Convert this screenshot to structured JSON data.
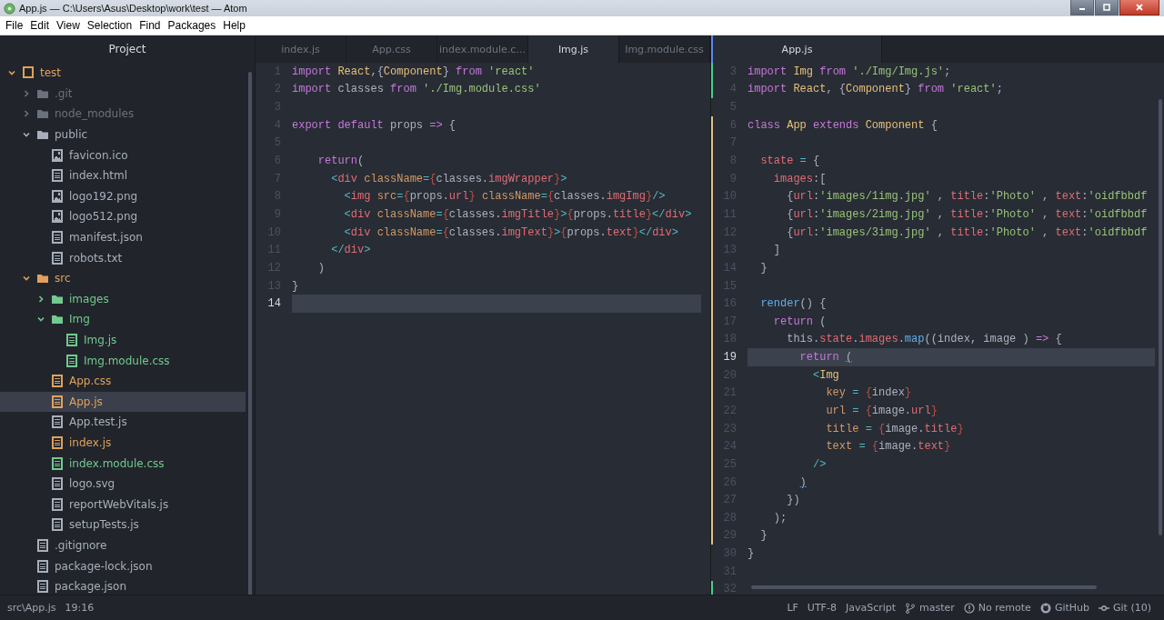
{
  "window": {
    "title": "App.js — C:\\Users\\Asus\\Desktop\\work\\test — Atom"
  },
  "menu": [
    "File",
    "Edit",
    "View",
    "Selection",
    "Find",
    "Packages",
    "Help"
  ],
  "sidebar": {
    "title": "Project",
    "tree": [
      {
        "name": "test",
        "kind": "repo",
        "color": "#e0a15d",
        "expanded": true,
        "selected": false,
        "children": [
          {
            "name": ".git",
            "kind": "folder",
            "color": "#6b717d",
            "expanded": false,
            "selected": false
          },
          {
            "name": "node_modules",
            "kind": "folder",
            "color": "#6b717d",
            "expanded": false,
            "selected": false
          },
          {
            "name": "public",
            "kind": "folder",
            "color": "#a8afbb",
            "expanded": true,
            "selected": false,
            "children": [
              {
                "name": "favicon.ico",
                "kind": "image",
                "color": "#a8afbb",
                "selected": false
              },
              {
                "name": "index.html",
                "kind": "file",
                "color": "#a8afbb",
                "selected": false
              },
              {
                "name": "logo192.png",
                "kind": "image",
                "color": "#a8afbb",
                "selected": false
              },
              {
                "name": "logo512.png",
                "kind": "image",
                "color": "#a8afbb",
                "selected": false
              },
              {
                "name": "manifest.json",
                "kind": "file",
                "color": "#a8afbb",
                "selected": false
              },
              {
                "name": "robots.txt",
                "kind": "file",
                "color": "#a8afbb",
                "selected": false
              }
            ]
          },
          {
            "name": "src",
            "kind": "folder",
            "color": "#e0a15d",
            "expanded": true,
            "selected": false,
            "children": [
              {
                "name": "images",
                "kind": "folder",
                "color": "#73c990",
                "expanded": false,
                "selected": false
              },
              {
                "name": "Img",
                "kind": "folder",
                "color": "#73c990",
                "expanded": true,
                "selected": false,
                "children": [
                  {
                    "name": "Img.js",
                    "kind": "file",
                    "color": "#73c990",
                    "selected": false
                  },
                  {
                    "name": "Img.module.css",
                    "kind": "file",
                    "color": "#73c990",
                    "selected": false
                  }
                ]
              },
              {
                "name": "App.css",
                "kind": "file",
                "color": "#e0a15d",
                "selected": false
              },
              {
                "name": "App.js",
                "kind": "file",
                "color": "#e0a15d",
                "selected": true
              },
              {
                "name": "App.test.js",
                "kind": "file",
                "color": "#a8afbb",
                "selected": false
              },
              {
                "name": "index.js",
                "kind": "file",
                "color": "#e0a15d",
                "selected": false
              },
              {
                "name": "index.module.css",
                "kind": "file",
                "color": "#73c990",
                "selected": false
              },
              {
                "name": "logo.svg",
                "kind": "file",
                "color": "#a8afbb",
                "selected": false
              },
              {
                "name": "reportWebVitals.js",
                "kind": "file",
                "color": "#a8afbb",
                "selected": false
              },
              {
                "name": "setupTests.js",
                "kind": "file",
                "color": "#a8afbb",
                "selected": false
              }
            ]
          },
          {
            "name": ".gitignore",
            "kind": "file",
            "color": "#a8afbb",
            "selected": false
          },
          {
            "name": "package-lock.json",
            "kind": "file",
            "color": "#a8afbb",
            "selected": false
          },
          {
            "name": "package.json",
            "kind": "file",
            "color": "#a8afbb",
            "selected": false
          }
        ]
      }
    ]
  },
  "panes": [
    {
      "tabs": [
        {
          "label": "index.js",
          "selected": false
        },
        {
          "label": "App.css",
          "selected": false
        },
        {
          "label": "index.module.c...",
          "selected": false
        },
        {
          "label": "Img.js",
          "selected": true
        },
        {
          "label": "Img.module.css",
          "selected": false
        }
      ],
      "lines": [
        {
          "number": "1",
          "current": false,
          "tokens": [
            {
              "kind": "kw",
              "text": "import "
            },
            {
              "kind": "cls",
              "text": "React"
            },
            {
              "kind": "plain",
              "text": ",{"
            },
            {
              "kind": "cls",
              "text": "Component"
            },
            {
              "kind": "plain",
              "text": "} "
            },
            {
              "kind": "kw",
              "text": "from "
            },
            {
              "kind": "str",
              "text": "'react'"
            }
          ]
        },
        {
          "number": "2",
          "current": false,
          "tokens": [
            {
              "kind": "kw",
              "text": "import "
            },
            {
              "kind": "plain",
              "text": "classes "
            },
            {
              "kind": "kw",
              "text": "from "
            },
            {
              "kind": "str",
              "text": "'./Img.module.css'"
            }
          ]
        },
        {
          "number": "3",
          "current": false
        },
        {
          "number": "4",
          "current": false,
          "tokens": [
            {
              "kind": "kw",
              "text": "export default "
            },
            {
              "kind": "plain",
              "text": "props "
            },
            {
              "kind": "kw",
              "text": "=> "
            },
            {
              "kind": "plain",
              "text": "{"
            }
          ]
        },
        {
          "number": "5",
          "current": false
        },
        {
          "number": "6",
          "current": false,
          "tokens": [
            {
              "kind": "kw",
              "text": "    return"
            },
            {
              "kind": "plain",
              "text": "("
            }
          ]
        },
        {
          "number": "7",
          "current": false,
          "tokens": [
            {
              "kind": "op",
              "text": "      <"
            },
            {
              "kind": "tag",
              "text": "div "
            },
            {
              "kind": "attr",
              "text": "className"
            },
            {
              "kind": "op",
              "text": "="
            },
            {
              "kind": "brace",
              "text": "{"
            },
            {
              "kind": "plain",
              "text": "classes."
            },
            {
              "kind": "prop",
              "text": "imgWrapper"
            },
            {
              "kind": "brace",
              "text": "}"
            },
            {
              "kind": "op",
              "text": ">"
            }
          ]
        },
        {
          "number": "8",
          "current": false,
          "tokens": [
            {
              "kind": "op",
              "text": "        <"
            },
            {
              "kind": "tag",
              "text": "img "
            },
            {
              "kind": "attr",
              "text": "src"
            },
            {
              "kind": "op",
              "text": "="
            },
            {
              "kind": "brace",
              "text": "{"
            },
            {
              "kind": "plain",
              "text": "props."
            },
            {
              "kind": "prop",
              "text": "url"
            },
            {
              "kind": "brace",
              "text": "} "
            },
            {
              "kind": "attr",
              "text": "className"
            },
            {
              "kind": "op",
              "text": "="
            },
            {
              "kind": "brace",
              "text": "{"
            },
            {
              "kind": "plain",
              "text": "classes."
            },
            {
              "kind": "prop",
              "text": "imgImg"
            },
            {
              "kind": "brace",
              "text": "}"
            },
            {
              "kind": "op",
              "text": "/>"
            }
          ]
        },
        {
          "number": "9",
          "current": false,
          "tokens": [
            {
              "kind": "op",
              "text": "        <"
            },
            {
              "kind": "tag",
              "text": "div "
            },
            {
              "kind": "attr",
              "text": "className"
            },
            {
              "kind": "op",
              "text": "="
            },
            {
              "kind": "brace",
              "text": "{"
            },
            {
              "kind": "plain",
              "text": "classes."
            },
            {
              "kind": "prop",
              "text": "imgTitle"
            },
            {
              "kind": "brace",
              "text": "}"
            },
            {
              "kind": "op",
              "text": ">"
            },
            {
              "kind": "brace",
              "text": "{"
            },
            {
              "kind": "plain",
              "text": "props."
            },
            {
              "kind": "prop",
              "text": "title"
            },
            {
              "kind": "brace",
              "text": "}"
            },
            {
              "kind": "op",
              "text": "</"
            },
            {
              "kind": "tag",
              "text": "div"
            },
            {
              "kind": "op",
              "text": ">"
            }
          ]
        },
        {
          "number": "10",
          "current": false,
          "tokens": [
            {
              "kind": "op",
              "text": "        <"
            },
            {
              "kind": "tag",
              "text": "div "
            },
            {
              "kind": "attr",
              "text": "className"
            },
            {
              "kind": "op",
              "text": "="
            },
            {
              "kind": "brace",
              "text": "{"
            },
            {
              "kind": "plain",
              "text": "classes."
            },
            {
              "kind": "prop",
              "text": "imgText"
            },
            {
              "kind": "brace",
              "text": "}"
            },
            {
              "kind": "op",
              "text": ">"
            },
            {
              "kind": "brace",
              "text": "{"
            },
            {
              "kind": "plain",
              "text": "props."
            },
            {
              "kind": "prop",
              "text": "text"
            },
            {
              "kind": "brace",
              "text": "}"
            },
            {
              "kind": "op",
              "text": "</"
            },
            {
              "kind": "tag",
              "text": "div"
            },
            {
              "kind": "op",
              "text": ">"
            }
          ]
        },
        {
          "number": "11",
          "current": false,
          "tokens": [
            {
              "kind": "op",
              "text": "      </"
            },
            {
              "kind": "tag",
              "text": "div"
            },
            {
              "kind": "op",
              "text": ">"
            }
          ]
        },
        {
          "number": "12",
          "current": false,
          "tokens": [
            {
              "kind": "plain",
              "text": "    )"
            }
          ]
        },
        {
          "number": "13",
          "current": false,
          "tokens": [
            {
              "kind": "plain",
              "text": "}"
            }
          ]
        },
        {
          "number": "14",
          "current": true
        }
      ]
    },
    {
      "tabs": [
        {
          "label": "App.js",
          "selected": true
        }
      ],
      "lines": [
        {
          "number": "3",
          "current": false,
          "color": "#43d08a",
          "tokens": [
            {
              "kind": "kw",
              "text": "import "
            },
            {
              "kind": "cls",
              "text": "Img "
            },
            {
              "kind": "kw",
              "text": "from "
            },
            {
              "kind": "str",
              "text": "'./Img/Img.js'"
            },
            {
              "kind": "plain",
              "text": ";"
            }
          ]
        },
        {
          "number": "4",
          "current": false,
          "color": "#43d08a",
          "tokens": [
            {
              "kind": "kw",
              "text": "import "
            },
            {
              "kind": "cls",
              "text": "React"
            },
            {
              "kind": "plain",
              "text": ", {"
            },
            {
              "kind": "cls",
              "text": "Component"
            },
            {
              "kind": "plain",
              "text": "} "
            },
            {
              "kind": "kw",
              "text": "from "
            },
            {
              "kind": "str",
              "text": "'react'"
            },
            {
              "kind": "plain",
              "text": ";"
            }
          ]
        },
        {
          "number": "5",
          "current": false
        },
        {
          "number": "6",
          "current": false,
          "color": "#e0c285",
          "tokens": [
            {
              "kind": "kw",
              "text": "class "
            },
            {
              "kind": "cls",
              "text": "App "
            },
            {
              "kind": "kw",
              "text": "extends "
            },
            {
              "kind": "cls",
              "text": "Component "
            },
            {
              "kind": "plain",
              "text": "{"
            }
          ]
        },
        {
          "number": "7",
          "current": false,
          "color": "#e0c285"
        },
        {
          "number": "8",
          "current": false,
          "color": "#e0c285",
          "tokens": [
            {
              "kind": "prop",
              "text": "  state "
            },
            {
              "kind": "op",
              "text": "= "
            },
            {
              "kind": "plain",
              "text": "{"
            }
          ]
        },
        {
          "number": "9",
          "current": false,
          "color": "#e0c285",
          "tokens": [
            {
              "kind": "prop",
              "text": "    images"
            },
            {
              "kind": "plain",
              "text": ":["
            }
          ]
        },
        {
          "number": "10",
          "current": false,
          "color": "#e0c285",
          "tokens": [
            {
              "kind": "plain",
              "text": "      {"
            },
            {
              "kind": "prop",
              "text": "url"
            },
            {
              "kind": "plain",
              "text": ":"
            },
            {
              "kind": "str",
              "text": "'images/1img.jpg'"
            },
            {
              "kind": "plain",
              "text": " , "
            },
            {
              "kind": "prop",
              "text": "title"
            },
            {
              "kind": "plain",
              "text": ":"
            },
            {
              "kind": "str",
              "text": "'Photo'"
            },
            {
              "kind": "plain",
              "text": " , "
            },
            {
              "kind": "prop",
              "text": "text"
            },
            {
              "kind": "plain",
              "text": ":"
            },
            {
              "kind": "str",
              "text": "'oidfbbdf"
            }
          ]
        },
        {
          "number": "11",
          "current": false,
          "color": "#e0c285",
          "tokens": [
            {
              "kind": "plain",
              "text": "      {"
            },
            {
              "kind": "prop",
              "text": "url"
            },
            {
              "kind": "plain",
              "text": ":"
            },
            {
              "kind": "str",
              "text": "'images/2img.jpg'"
            },
            {
              "kind": "plain",
              "text": " , "
            },
            {
              "kind": "prop",
              "text": "title"
            },
            {
              "kind": "plain",
              "text": ":"
            },
            {
              "kind": "str",
              "text": "'Photo'"
            },
            {
              "kind": "plain",
              "text": " , "
            },
            {
              "kind": "prop",
              "text": "text"
            },
            {
              "kind": "plain",
              "text": ":"
            },
            {
              "kind": "str",
              "text": "'oidfbbdf"
            }
          ]
        },
        {
          "number": "12",
          "current": false,
          "color": "#e0c285",
          "tokens": [
            {
              "kind": "plain",
              "text": "      {"
            },
            {
              "kind": "prop",
              "text": "url"
            },
            {
              "kind": "plain",
              "text": ":"
            },
            {
              "kind": "str",
              "text": "'images/3img.jpg'"
            },
            {
              "kind": "plain",
              "text": " , "
            },
            {
              "kind": "prop",
              "text": "title"
            },
            {
              "kind": "plain",
              "text": ":"
            },
            {
              "kind": "str",
              "text": "'Photo'"
            },
            {
              "kind": "plain",
              "text": " , "
            },
            {
              "kind": "prop",
              "text": "text"
            },
            {
              "kind": "plain",
              "text": ":"
            },
            {
              "kind": "str",
              "text": "'oidfbbdf"
            }
          ]
        },
        {
          "number": "13",
          "current": false,
          "color": "#e0c285",
          "tokens": [
            {
              "kind": "plain",
              "text": "    ]"
            }
          ]
        },
        {
          "number": "14",
          "current": false,
          "color": "#e0c285",
          "tokens": [
            {
              "kind": "plain",
              "text": "  }"
            }
          ]
        },
        {
          "number": "15",
          "current": false,
          "color": "#e0c285"
        },
        {
          "number": "16",
          "current": false,
          "color": "#e0c285",
          "tokens": [
            {
              "kind": "fn",
              "text": "  render"
            },
            {
              "kind": "plain",
              "text": "() {"
            }
          ]
        },
        {
          "number": "17",
          "current": false,
          "color": "#e0c285",
          "tokens": [
            {
              "kind": "kw",
              "text": "    return "
            },
            {
              "kind": "plain",
              "text": "("
            }
          ]
        },
        {
          "number": "18",
          "current": false,
          "color": "#e0c285",
          "tokens": [
            {
              "kind": "plain",
              "text": "      this."
            },
            {
              "kind": "prop",
              "text": "state"
            },
            {
              "kind": "plain",
              "text": "."
            },
            {
              "kind": "prop",
              "text": "images"
            },
            {
              "kind": "plain",
              "text": "."
            },
            {
              "kind": "fn",
              "text": "map"
            },
            {
              "kind": "plain",
              "text": "((index, image ) "
            },
            {
              "kind": "kw",
              "text": "=> "
            },
            {
              "kind": "plain",
              "text": "{"
            }
          ]
        },
        {
          "number": "19",
          "current": true,
          "color": "#e0c285",
          "tokens": [
            {
              "kind": "kw",
              "text": "        return "
            },
            {
              "kind": "match",
              "text": "("
            }
          ]
        },
        {
          "number": "20",
          "current": false,
          "color": "#e0c285",
          "tokens": [
            {
              "kind": "op",
              "text": "          <"
            },
            {
              "kind": "cls",
              "text": "Img"
            }
          ]
        },
        {
          "number": "21",
          "current": false,
          "color": "#e0c285",
          "tokens": [
            {
              "kind": "attr",
              "text": "            key "
            },
            {
              "kind": "op",
              "text": "= "
            },
            {
              "kind": "brace",
              "text": "{"
            },
            {
              "kind": "plain",
              "text": "index"
            },
            {
              "kind": "brace",
              "text": "}"
            }
          ]
        },
        {
          "number": "22",
          "current": false,
          "color": "#e0c285",
          "tokens": [
            {
              "kind": "attr",
              "text": "            url "
            },
            {
              "kind": "op",
              "text": "= "
            },
            {
              "kind": "brace",
              "text": "{"
            },
            {
              "kind": "plain",
              "text": "image."
            },
            {
              "kind": "prop",
              "text": "url"
            },
            {
              "kind": "brace",
              "text": "}"
            }
          ]
        },
        {
          "number": "23",
          "current": false,
          "color": "#e0c285",
          "tokens": [
            {
              "kind": "attr",
              "text": "            title "
            },
            {
              "kind": "op",
              "text": "= "
            },
            {
              "kind": "brace",
              "text": "{"
            },
            {
              "kind": "plain",
              "text": "image."
            },
            {
              "kind": "prop",
              "text": "title"
            },
            {
              "kind": "brace",
              "text": "}"
            }
          ]
        },
        {
          "number": "24",
          "current": false,
          "color": "#e0c285",
          "tokens": [
            {
              "kind": "attr",
              "text": "            text "
            },
            {
              "kind": "op",
              "text": "= "
            },
            {
              "kind": "brace",
              "text": "{"
            },
            {
              "kind": "plain",
              "text": "image."
            },
            {
              "kind": "prop",
              "text": "text"
            },
            {
              "kind": "brace",
              "text": "}"
            }
          ]
        },
        {
          "number": "25",
          "current": false,
          "color": "#e0c285",
          "tokens": [
            {
              "kind": "op",
              "text": "          />"
            }
          ]
        },
        {
          "number": "26",
          "current": false,
          "color": "#e0c285",
          "tokens": [
            {
              "kind": "match",
              "text": "        )"
            }
          ]
        },
        {
          "number": "27",
          "current": false,
          "color": "#e0c285",
          "tokens": [
            {
              "kind": "plain",
              "text": "      })"
            }
          ]
        },
        {
          "number": "28",
          "current": false,
          "color": "#e0c285",
          "tokens": [
            {
              "kind": "plain",
              "text": "    );"
            }
          ]
        },
        {
          "number": "29",
          "current": false,
          "color": "#e0c285",
          "tokens": [
            {
              "kind": "plain",
              "text": "  }"
            }
          ]
        },
        {
          "number": "30",
          "current": false,
          "tokens": [
            {
              "kind": "plain",
              "text": "}"
            }
          ]
        },
        {
          "number": "31",
          "current": false
        },
        {
          "number": "32",
          "current": false,
          "color": "#43d08a"
        }
      ]
    }
  ],
  "status_bar": {
    "path": "src\\App.js",
    "cursor": "19:16",
    "line_ending": "LF",
    "encoding": "UTF-8",
    "grammar": "JavaScript",
    "branch": "master",
    "remote": "No remote",
    "github": "GitHub",
    "git": "Git (10)"
  }
}
